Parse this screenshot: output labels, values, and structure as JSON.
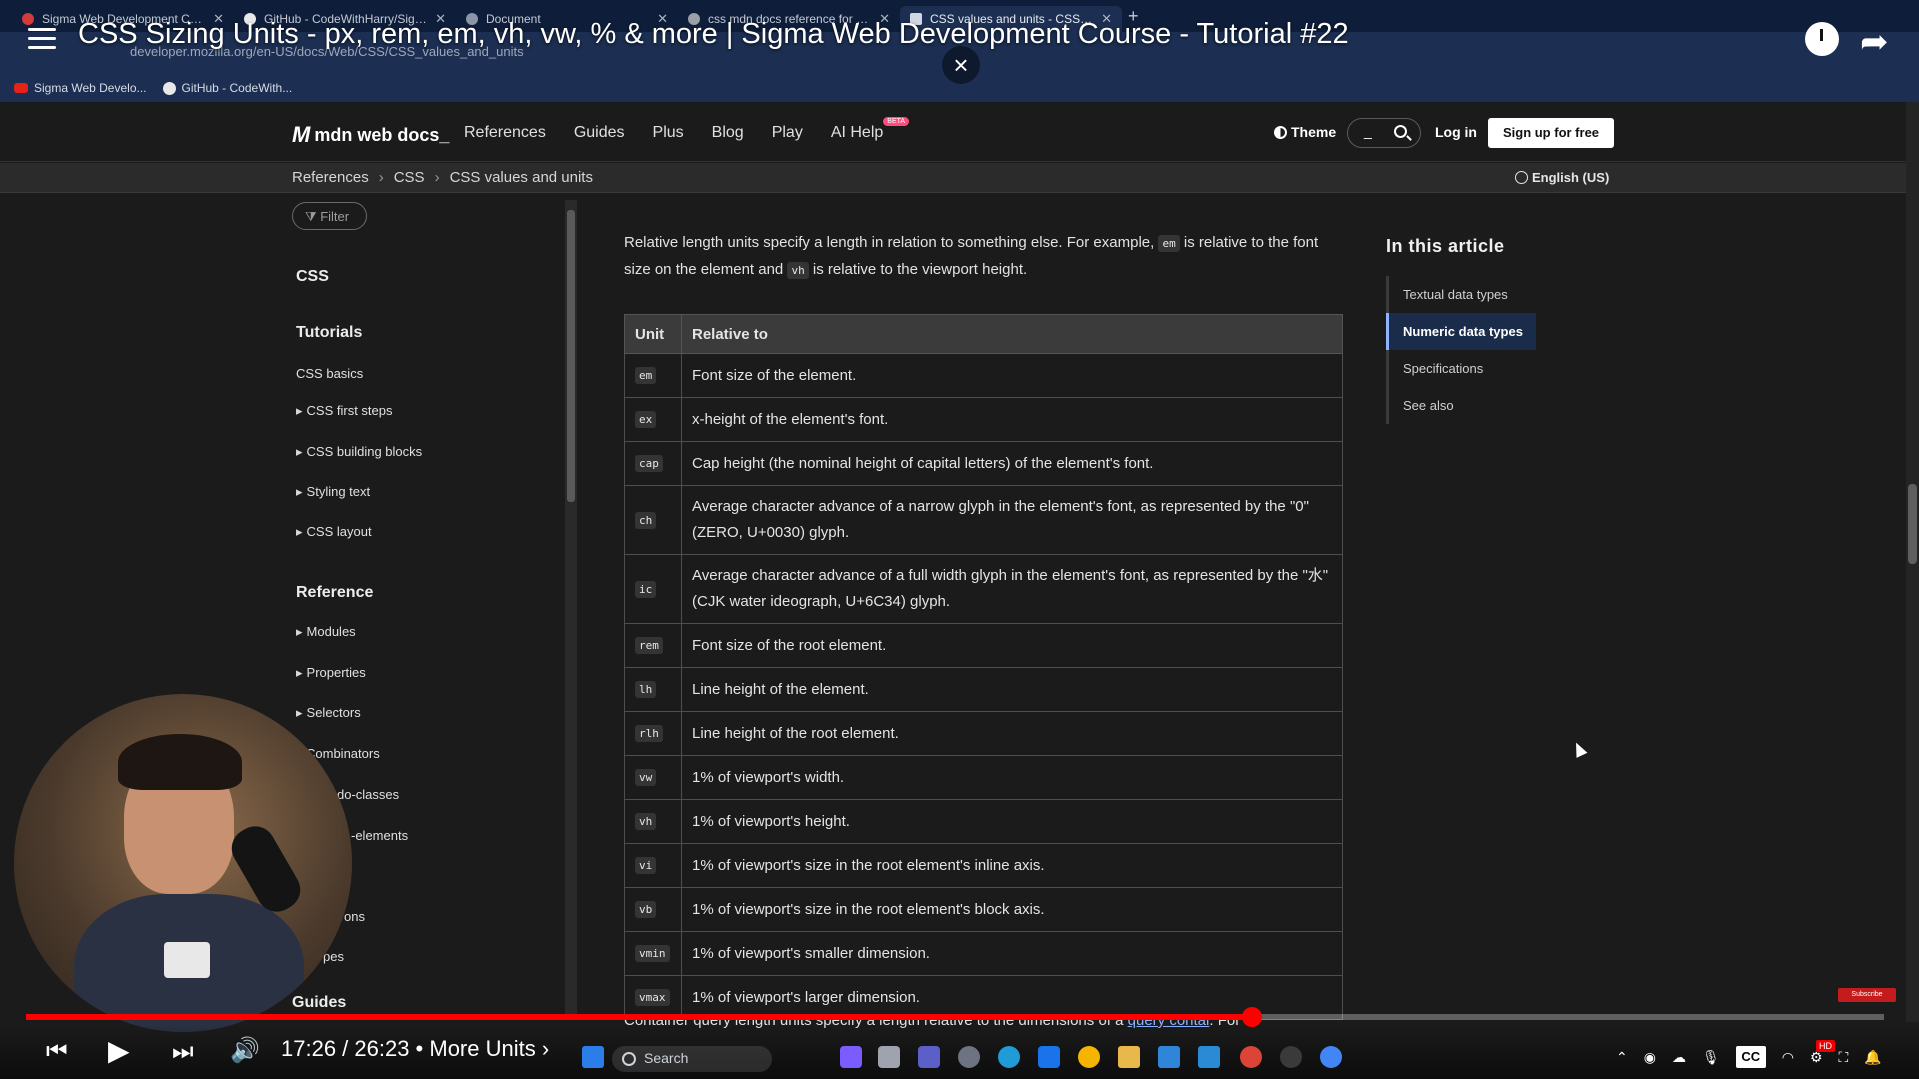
{
  "browser": {
    "tabs": [
      {
        "label": "Sigma Web Development Cours",
        "icon": "youtube-icon"
      },
      {
        "label": "GitHub - CodeWithHarry/Sigma",
        "icon": "github-icon"
      },
      {
        "label": "Document",
        "icon": "document-icon"
      },
      {
        "label": "css mdn docs reference for unit",
        "icon": "google-icon"
      },
      {
        "label": "CSS values and units - CSS: Cas",
        "icon": "mdn-icon"
      }
    ],
    "new_tab": "+",
    "url": "developer.mozilla.org/en-US/docs/Web/CSS/CSS_values_and_units",
    "bookmarks": [
      {
        "label": "Sigma Web Develo...",
        "icon": "youtube-icon"
      },
      {
        "label": "GitHub - CodeWith...",
        "icon": "github-icon"
      }
    ]
  },
  "video": {
    "title": "CSS Sizing Units - px, rem, em, vh, vw, % & more | Sigma Web Development Course - Tutorial #22",
    "close_symbol": "×",
    "time": "17:26 / 26:23 • More Units ›",
    "progress": 0.66,
    "cc": "CC",
    "hd": "HD",
    "subscribe": "Subscribe"
  },
  "mdn": {
    "logo": "mdn web docs_",
    "nav": [
      "References",
      "Guides",
      "Plus",
      "Blog",
      "Play"
    ],
    "ai_help": "AI Help",
    "beta": "BETA",
    "theme": "Theme",
    "search_placeholder": "_",
    "login": "Log in",
    "signup": "Sign up for free",
    "breadcrumbs": [
      "References",
      "CSS",
      "CSS values and units"
    ],
    "language": "English (US)"
  },
  "sidebar": {
    "filter": "Filter",
    "css": "CSS",
    "tutorials": "Tutorials",
    "tutorial_items": [
      "CSS basics",
      "CSS first steps",
      "CSS building blocks",
      "Styling text",
      "CSS layout"
    ],
    "reference": "Reference",
    "reference_items": [
      "Modules",
      "Properties",
      "Selectors",
      "Combinators",
      "do-classes",
      "-elements",
      "ons",
      "pes"
    ],
    "guides": "Guides"
  },
  "content": {
    "intro_1": "Relative length units specify a length in relation to something else. For example, ",
    "intro_code_1": "em",
    "intro_2": " is relative to the font size on the element and ",
    "intro_code_2": "vh",
    "intro_3": " is relative to the viewport height.",
    "table_headers": [
      "Unit",
      "Relative to"
    ],
    "rows": [
      {
        "unit": "em",
        "desc": "Font size of the element."
      },
      {
        "unit": "ex",
        "desc": "x-height of the element's font."
      },
      {
        "unit": "cap",
        "desc": "Cap height (the nominal height of capital letters) of the element's font."
      },
      {
        "unit": "ch",
        "desc": "Average character advance of a narrow glyph in the element's font, as represented by the \"0\" (ZERO, U+0030) glyph."
      },
      {
        "unit": "ic",
        "desc": "Average character advance of a full width glyph in the element's font, as represented by the \"水\" (CJK water ideograph, U+6C34) glyph."
      },
      {
        "unit": "rem",
        "desc": "Font size of the root element."
      },
      {
        "unit": "lh",
        "desc": "Line height of the element."
      },
      {
        "unit": "rlh",
        "desc": "Line height of the root element."
      },
      {
        "unit": "vw",
        "desc": "1% of viewport's width."
      },
      {
        "unit": "vh",
        "desc": "1% of viewport's height."
      },
      {
        "unit": "vi",
        "desc": "1% of viewport's size in the root element's inline axis."
      },
      {
        "unit": "vb",
        "desc": "1% of viewport's size in the root element's block axis."
      },
      {
        "unit": "vmin",
        "desc": "1% of viewport's smaller dimension."
      },
      {
        "unit": "vmax",
        "desc": "1% of viewport's larger dimension."
      }
    ],
    "cut_1": "Container query length units specify a length relative to the dimensions of a ",
    "cut_link": "query contai",
    "cut_2": ". For"
  },
  "toc": {
    "title": "In this article",
    "items": [
      "Textual data types",
      "Numeric data types",
      "Specifications",
      "See also"
    ],
    "active_index": 1
  },
  "taskbar": {
    "search": "Search"
  }
}
